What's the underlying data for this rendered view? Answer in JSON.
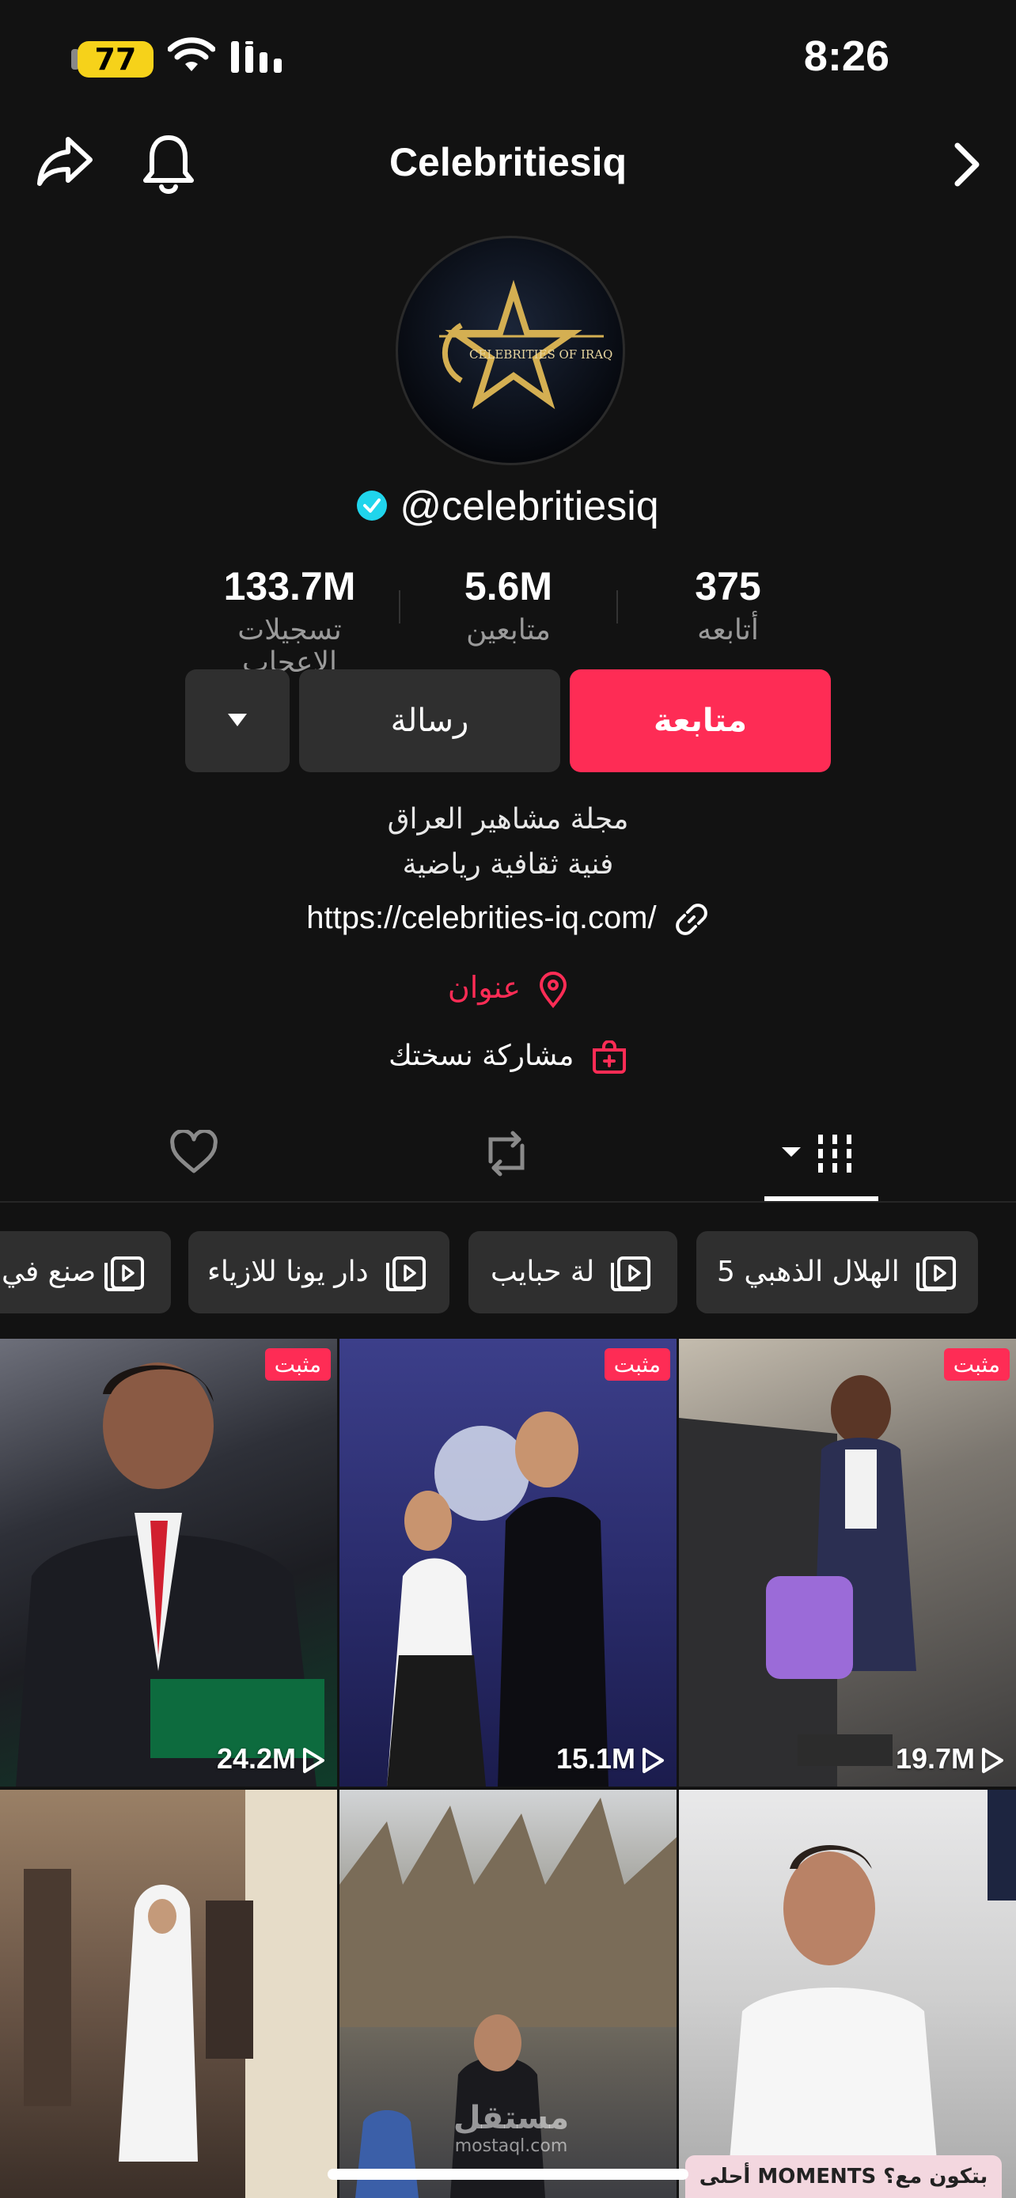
{
  "status_bar": {
    "battery": "77",
    "time": "8:26"
  },
  "header": {
    "title": "Celebritiesiq"
  },
  "profile": {
    "avatar_text": "CELEBRITIES OF IRAQ",
    "handle": "@celebritiesiq",
    "verified": true,
    "stats": {
      "likes_value": "133.7M",
      "likes_label": "تسجيلات الإعجاب",
      "followers_value": "5.6M",
      "followers_label": "متابعين",
      "following_value": "375",
      "following_label": "أتابعه"
    },
    "buttons": {
      "follow": "متابعة",
      "message": "رسالة"
    },
    "bio_line1": "مجلة مشاهير العراق",
    "bio_line2": "فنية ثقافية رياضية",
    "link": "https://celebrities-iq.com/",
    "address": "عنوان",
    "share_copy": "مشاركة نسختك"
  },
  "playlists": [
    "الهلال الذهبي 5",
    "لة حبايب",
    "دار يونا للازياء",
    "صنع في"
  ],
  "grid": [
    {
      "views": "24.2M",
      "pinned_label": "مثبت"
    },
    {
      "views": "15.1M",
      "pinned_label": "مثبت"
    },
    {
      "views": "19.7M",
      "pinned_label": "مثبت"
    },
    {
      "views": ""
    },
    {
      "views": ""
    },
    {
      "views": ""
    }
  ],
  "overlay": {
    "watermark_arabic": "مستقل",
    "watermark_latin": "mostaql.com",
    "banner_text": "أحلى MOMENTS بتكون مع؟"
  },
  "colors": {
    "accent": "#fe2c55",
    "verified": "#20d5ec",
    "background": "#121212"
  }
}
